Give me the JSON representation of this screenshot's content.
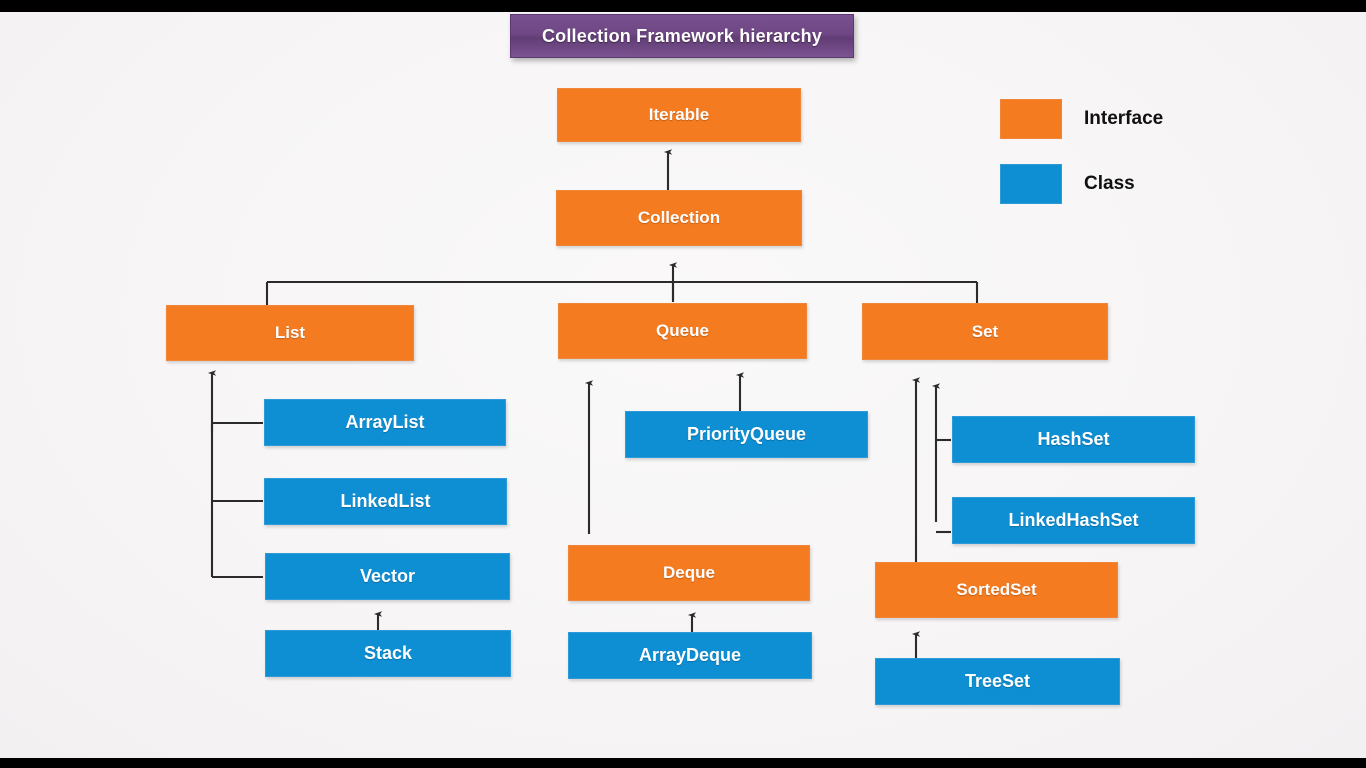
{
  "title": {
    "text": "Collection Framework hierarchy"
  },
  "legend": {
    "items": [
      {
        "label": "Interface",
        "color": "#f47b20",
        "kind": "interface"
      },
      {
        "label": "Class",
        "color": "#0e8fd4",
        "kind": "class"
      }
    ]
  },
  "palette": {
    "interface": "#f47b20",
    "class": "#0e8fd4",
    "title_banner": "#6f4784",
    "background": "#f7f5f5",
    "connector": "#2b2b2b",
    "letterbox": "#000000"
  },
  "diagram": {
    "type": "hierarchy",
    "nodes": [
      {
        "id": "iterable",
        "label": "Iterable",
        "kind": "interface"
      },
      {
        "id": "collection",
        "label": "Collection",
        "kind": "interface"
      },
      {
        "id": "list",
        "label": "List",
        "kind": "interface"
      },
      {
        "id": "queue",
        "label": "Queue",
        "kind": "interface"
      },
      {
        "id": "set",
        "label": "Set",
        "kind": "interface"
      },
      {
        "id": "arraylist",
        "label": "ArrayList",
        "kind": "class"
      },
      {
        "id": "linkedlist",
        "label": "LinkedList",
        "kind": "class"
      },
      {
        "id": "vector",
        "label": "Vector",
        "kind": "class"
      },
      {
        "id": "stack",
        "label": "Stack",
        "kind": "class"
      },
      {
        "id": "priorityqueue",
        "label": "PriorityQueue",
        "kind": "class"
      },
      {
        "id": "deque",
        "label": "Deque",
        "kind": "interface"
      },
      {
        "id": "arraydeque",
        "label": "ArrayDeque",
        "kind": "class"
      },
      {
        "id": "hashset",
        "label": "HashSet",
        "kind": "class"
      },
      {
        "id": "linkedhashset",
        "label": "LinkedHashSet",
        "kind": "class"
      },
      {
        "id": "sortedset",
        "label": "SortedSet",
        "kind": "interface"
      },
      {
        "id": "treeset",
        "label": "TreeSet",
        "kind": "class"
      }
    ],
    "edges": [
      {
        "from": "collection",
        "to": "iterable"
      },
      {
        "from": "list",
        "to": "collection"
      },
      {
        "from": "queue",
        "to": "collection"
      },
      {
        "from": "set",
        "to": "collection"
      },
      {
        "from": "arraylist",
        "to": "list"
      },
      {
        "from": "linkedlist",
        "to": "list"
      },
      {
        "from": "vector",
        "to": "list"
      },
      {
        "from": "stack",
        "to": "vector"
      },
      {
        "from": "priorityqueue",
        "to": "queue"
      },
      {
        "from": "deque",
        "to": "queue"
      },
      {
        "from": "arraydeque",
        "to": "deque"
      },
      {
        "from": "hashset",
        "to": "set"
      },
      {
        "from": "linkedhashset",
        "to": "set"
      },
      {
        "from": "sortedset",
        "to": "set"
      },
      {
        "from": "treeset",
        "to": "sortedset"
      }
    ]
  }
}
